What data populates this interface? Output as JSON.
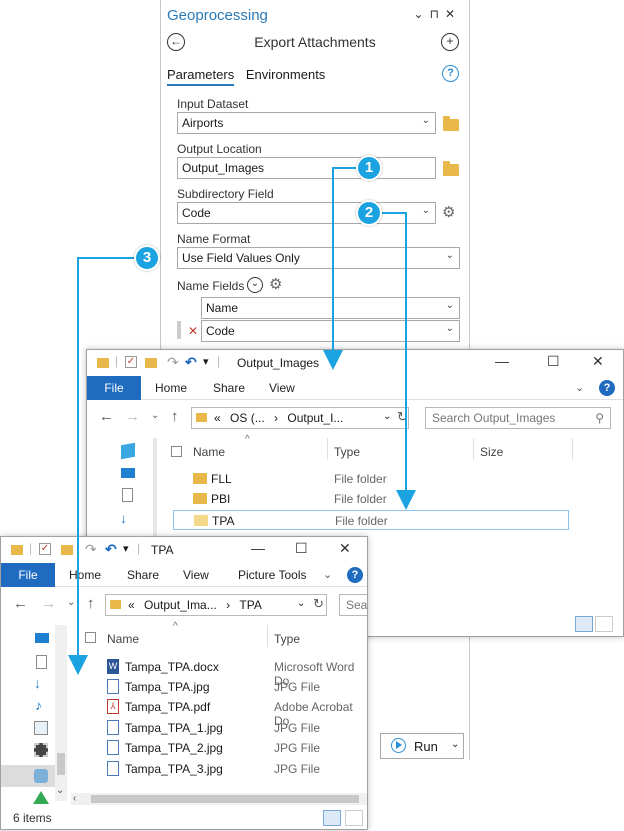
{
  "geoprocessing": {
    "title": "Geoprocessing",
    "window_buttons": "⌄ ⊓ ✕",
    "tool_name": "Export Attachments",
    "tabs": [
      "Parameters",
      "Environments"
    ],
    "input_dataset_label": "Input Dataset",
    "input_dataset_value": "Airports",
    "output_location_label": "Output Location",
    "output_location_value": "Output_Images",
    "subdirectory_field_label": "Subdirectory Field",
    "subdirectory_field_value": "Code",
    "name_format_label": "Name Format",
    "name_format_value": "Use Field Values Only",
    "name_fields_label": "Name Fields",
    "name_fields_values": [
      "Name",
      "Code"
    ],
    "run_label": "Run"
  },
  "explorer_output": {
    "title": "Output_Images",
    "ribbon_tabs": [
      "File",
      "Home",
      "Share",
      "View"
    ],
    "address": [
      "«",
      "OS (...",
      "›",
      "Output_I..."
    ],
    "search_placeholder": "Search Output_Images",
    "columns": [
      "Name",
      "Type",
      "Size"
    ],
    "rows": [
      {
        "name": "FLL",
        "type": "File folder"
      },
      {
        "name": "PBI",
        "type": "File folder"
      },
      {
        "name": "TPA",
        "type": "File folder"
      }
    ]
  },
  "explorer_tpa": {
    "title": "TPA",
    "ribbon_tabs": [
      "File",
      "Home",
      "Share",
      "View",
      "Picture Tools"
    ],
    "address": [
      "«",
      "Output_Ima...",
      "›",
      "TPA"
    ],
    "search_placeholder": "Sear",
    "columns": [
      "Name",
      "Type"
    ],
    "rows": [
      {
        "name": "Tampa_TPA.docx",
        "type": "Microsoft Word Do",
        "icon": "word-doc-icon"
      },
      {
        "name": "Tampa_TPA.jpg",
        "type": "JPG File",
        "icon": "jpg-file-icon"
      },
      {
        "name": "Tampa_TPA.pdf",
        "type": "Adobe Acrobat Do",
        "icon": "pdf-file-icon"
      },
      {
        "name": "Tampa_TPA_1.jpg",
        "type": "JPG File",
        "icon": "jpg-file-icon"
      },
      {
        "name": "Tampa_TPA_2.jpg",
        "type": "JPG File",
        "icon": "jpg-file-icon"
      },
      {
        "name": "Tampa_TPA_3.jpg",
        "type": "JPG File",
        "icon": "jpg-file-icon"
      }
    ],
    "status": "6 items"
  },
  "callouts": [
    "1",
    "2",
    "3"
  ],
  "colors": {
    "accent": "#1aa3e0",
    "file_tab": "#1f6bbf",
    "folder": "#e8b84a",
    "title_blue": "#2a7ab8"
  }
}
